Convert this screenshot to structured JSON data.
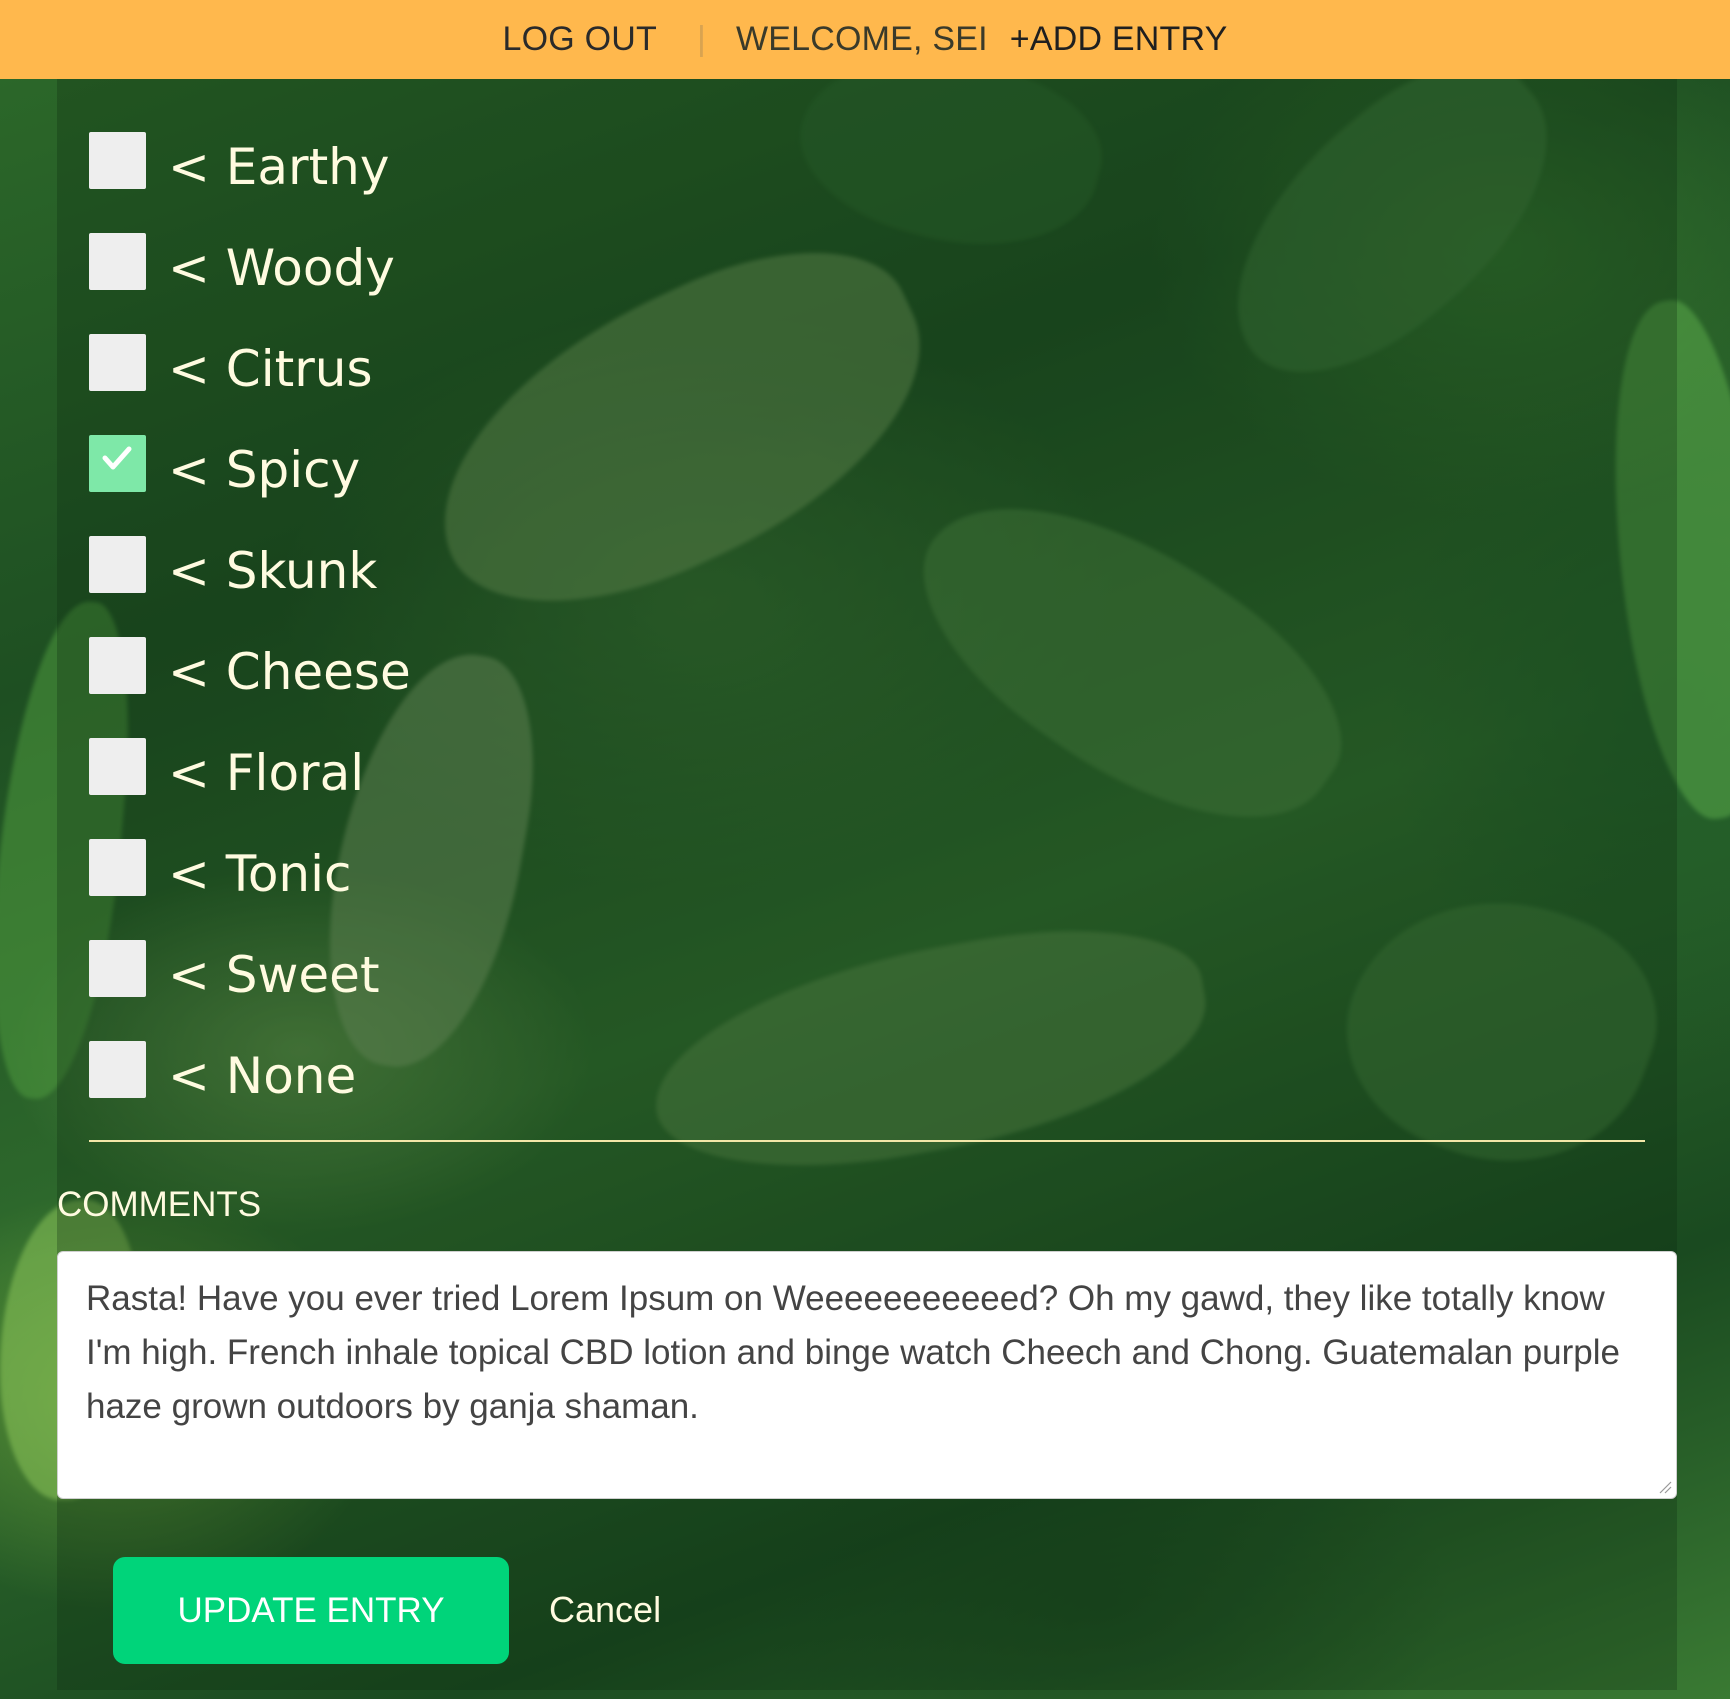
{
  "header": {
    "logout_label": "LOG OUT",
    "separator": "|",
    "welcome_text": "WELCOME, SEI",
    "add_entry_label": "+ADD ENTRY",
    "background_color": "#ffb84d"
  },
  "flavors": [
    {
      "label": "< Earthy",
      "checked": false
    },
    {
      "label": "< Woody",
      "checked": false
    },
    {
      "label": "< Citrus",
      "checked": false
    },
    {
      "label": "< Spicy",
      "checked": true
    },
    {
      "label": "< Skunk",
      "checked": false
    },
    {
      "label": "< Cheese",
      "checked": false
    },
    {
      "label": "< Floral",
      "checked": false
    },
    {
      "label": "< Tonic",
      "checked": false
    },
    {
      "label": "< Sweet",
      "checked": false
    },
    {
      "label": "< None",
      "checked": false
    }
  ],
  "comments": {
    "label": "COMMENTS",
    "value": "Rasta! Have you ever tried Lorem Ipsum on Weeeeeeeeeeed? Oh my gawd, they like totally know I'm high. French inhale topical CBD lotion and binge watch Cheech and Chong. Guatemalan purple haze grown outdoors by ganja shaman."
  },
  "actions": {
    "update_label": "UPDATE ENTRY",
    "cancel_label": "Cancel",
    "update_color": "#00d47a"
  },
  "colors": {
    "checkbox_checked": "#7ee8a8",
    "checkbox_unchecked": "#eeeeee",
    "text_light": "#fffbe0"
  }
}
